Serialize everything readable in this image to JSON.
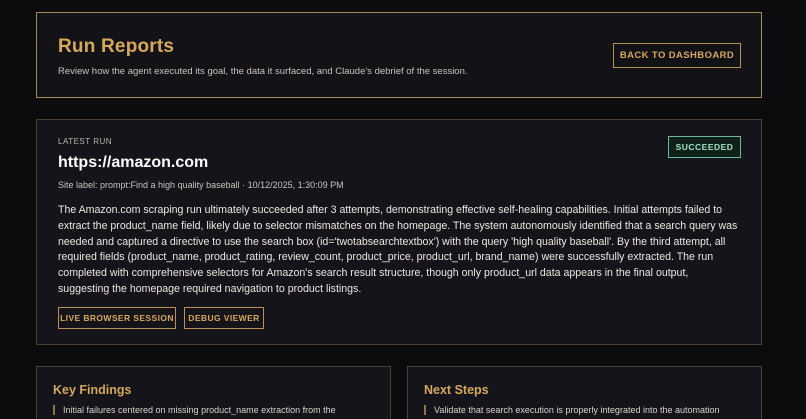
{
  "header": {
    "title": "Run Reports",
    "subtitle": "Review how the agent executed its goal, the data it surfaced, and Claude's debrief of the session.",
    "back_label": "BACK TO DASHBOARD"
  },
  "latest_run": {
    "eyebrow": "LATEST RUN",
    "url": "https://amazon.com",
    "site_label": "Site label: prompt:Find a high quality baseball · 10/12/2025, 1:30:09 PM",
    "status": "SUCCEEDED",
    "summary": "The Amazon.com scraping run ultimately succeeded after 3 attempts, demonstrating effective self-healing capabilities. Initial attempts failed to extract the product_name field, likely due to selector mismatches on the homepage. The system autonomously identified that a search query was needed and captured a directive to use the search box (id='twotabsearchtextbox') with the query 'high quality baseball'. By the third attempt, all required fields (product_name, product_rating, review_count, product_price, product_url, brand_name) were successfully extracted. The run completed with comprehensive selectors for Amazon's search result structure, though only product_url data appears in the final output, suggesting the homepage required navigation to product listings.",
    "live_label": "LIVE BROWSER SESSION",
    "debug_label": "DEBUG VIEWER"
  },
  "key_findings": {
    "title": "Key Findings",
    "items": [
      "Initial failures centered on missing product_name extraction from the"
    ]
  },
  "next_steps": {
    "title": "Next Steps",
    "items": [
      "Validate that search execution is properly integrated into the automation"
    ]
  },
  "colors": {
    "accent": "#d6a85c",
    "background": "#0c0c0f",
    "card": "#14141a",
    "success": "#9fe3c6"
  }
}
